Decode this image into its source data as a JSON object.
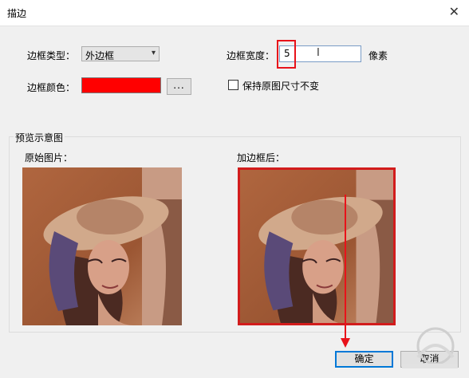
{
  "window": {
    "title": "描边",
    "close_glyph": "✕"
  },
  "border_type": {
    "label": "边框类型：",
    "value": "外边框",
    "arrow": "▾"
  },
  "border_color": {
    "label": "边框颜色：",
    "color": "#ff0000",
    "more_label": "..."
  },
  "border_width": {
    "label": "边框宽度：",
    "value": "5",
    "unit": "像素",
    "cursor_glyph": "I"
  },
  "keep_size": {
    "label": "保持原图尺寸不变",
    "checked": false
  },
  "preview": {
    "group_label": "预览示意图",
    "original_label": "原始图片：",
    "bordered_label": "加边框后："
  },
  "buttons": {
    "ok": "确定",
    "cancel": "取消"
  },
  "colors": {
    "highlight": "#e8121a",
    "border_preview": "#d21c1c",
    "accent": "#0078d7"
  }
}
